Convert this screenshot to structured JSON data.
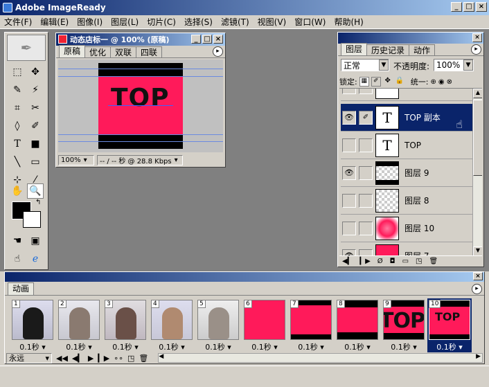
{
  "app": {
    "title": "Adobe ImageReady"
  },
  "menu": [
    "文件(F)",
    "编辑(E)",
    "图像(I)",
    "图层(L)",
    "切片(C)",
    "选择(S)",
    "滤镜(T)",
    "视图(V)",
    "窗口(W)",
    "帮助(H)"
  ],
  "document": {
    "title": "动态店标一 @ 100% (原稿)",
    "tabs": [
      "原稿",
      "优化",
      "双联",
      "四联"
    ],
    "canvas_text": "TOP",
    "zoom": "100%",
    "status": "-- / -- 秒 @ 28.8 Kbps"
  },
  "layers_panel": {
    "tabs": [
      "图层",
      "历史记录",
      "动作"
    ],
    "blend_mode": "正常",
    "opacity_label": "不透明度:",
    "opacity_value": "100%",
    "lock_label": "锁定:",
    "unify_label": "统一:",
    "layers": [
      {
        "name": "TOP 副本",
        "type": "text",
        "visible": true,
        "selected": true
      },
      {
        "name": "TOP",
        "type": "text",
        "visible": false,
        "selected": false
      },
      {
        "name": "图层 9",
        "type": "image",
        "visible": true,
        "selected": false
      },
      {
        "name": "图层 8",
        "type": "image",
        "visible": false,
        "selected": false
      },
      {
        "name": "图层 10",
        "type": "image",
        "visible": false,
        "selected": false
      },
      {
        "name": "图层 7",
        "type": "image",
        "visible": true,
        "selected": false
      }
    ]
  },
  "animation_panel": {
    "tab": "动画",
    "loop": "永远",
    "frames": [
      {
        "num": "1",
        "time": "0.1秒"
      },
      {
        "num": "2",
        "time": "0.1秒"
      },
      {
        "num": "3",
        "time": "0.1秒"
      },
      {
        "num": "4",
        "time": "0.1秒"
      },
      {
        "num": "5",
        "time": "0.1秒"
      },
      {
        "num": "6",
        "time": "0.1秒"
      },
      {
        "num": "7",
        "time": "0.1秒"
      },
      {
        "num": "8",
        "time": "0.1秒"
      },
      {
        "num": "9",
        "time": "0.1秒"
      },
      {
        "num": "10",
        "time": "0.1秒"
      }
    ]
  },
  "colors": {
    "accent": "#ff1a5a",
    "title_bar": "#0a246a"
  }
}
